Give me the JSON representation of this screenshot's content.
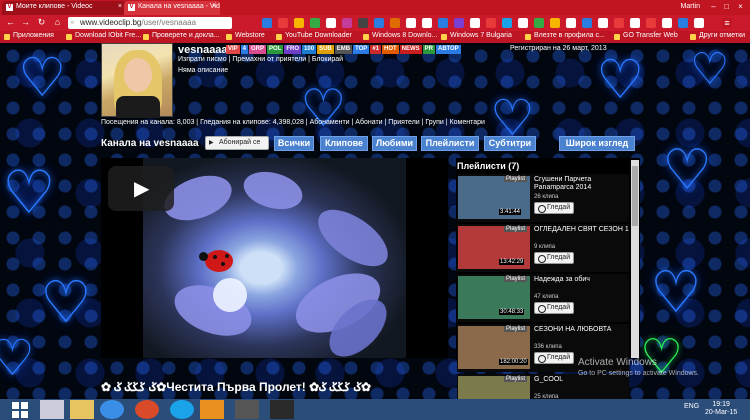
{
  "browser": {
    "tabs": [
      {
        "title": "Моите клипове - Videoc"
      },
      {
        "title": "Канала на vesnaaaa - Vid"
      }
    ],
    "user": "Martin",
    "url_host": "www.videoclip.bg",
    "url_path": "/user/vesnaaaa",
    "bookmarks": [
      "Приложения",
      "Download IObit Fre...",
      "Проверете и докла...",
      "Webstore",
      "YouTube Downloader",
      "Windows 8 Downlo...",
      "Windows 7 Bulgaria",
      "Влезте в профила с...",
      "GO Transfer Web",
      "Други отметки"
    ]
  },
  "channel": {
    "username": "vesnaaaa",
    "badges": [
      {
        "text": "VIP",
        "color": "#e04848"
      },
      {
        "text": "4",
        "color": "#2c7be5"
      },
      {
        "text": "GRP",
        "color": "#d94c8f"
      },
      {
        "text": "POL",
        "color": "#2c9a3c"
      },
      {
        "text": "FRO",
        "color": "#6f3fc8"
      },
      {
        "text": "100",
        "color": "#1c7dd0"
      },
      {
        "text": "SUB",
        "color": "#e0a000"
      },
      {
        "text": "EMB",
        "color": "#555555"
      },
      {
        "text": "TOP",
        "color": "#2c7be5"
      },
      {
        "text": "#1",
        "color": "#cc2a2a"
      },
      {
        "text": "HOT",
        "color": "#e05a00"
      },
      {
        "text": "NEWS",
        "color": "#c81e1e"
      },
      {
        "text": "PR",
        "color": "#2c9a3c"
      },
      {
        "text": "АВТОР",
        "color": "#2c7be5"
      }
    ],
    "registered": "Регистриран на 26 март, 2013",
    "links": "Изпрати писмо | Премахни от приятели | Блокирай",
    "no_name": "Няма описание",
    "stats": "Посещения на канала: 8,003 | Гледания на клипове: 4,398,028 | Абонаменти | Абонати | Приятели | Групи | Коментари",
    "channel_title": "Канала на vesnaaaa",
    "subscribe_label": "Абонирай се",
    "tabs": [
      "Всички",
      "Клипове",
      "Любими",
      "Плейлисти",
      "Субтитри"
    ],
    "wide_label": "Широк изглед",
    "video_caption": "✿ ݢ ݢݢݢ ݢ✿Честита Първа Пролет! ✿ݢ ݢݢݢ ݢ✿"
  },
  "playlists": {
    "title": "Плейлисти (7)",
    "tag": "Playlist",
    "watch_label": "Гледай",
    "items": [
      {
        "name": "Сгушени Парчета Panamparca 2014",
        "clips": "26 клипа",
        "duration": "3:41:44",
        "thumb": "#4a6a8a"
      },
      {
        "name": "ОГЛЕДАЛЕН СВЯТ СЕЗОН 1",
        "clips": "9 клипа",
        "duration": "13:42:29",
        "thumb": "#b23a3a"
      },
      {
        "name": "Надежда за обич",
        "clips": "47 клипа",
        "duration": "30:48:33",
        "thumb": "#3a7a5a"
      },
      {
        "name": "СЕЗОНИ НА ЛЮБОВТА",
        "clips": "336 клипа",
        "duration": "182:00:20",
        "thumb": "#8a6a4a"
      },
      {
        "name": "G_COOL",
        "clips": "25 клипа",
        "duration": "1:52:27",
        "thumb": "#7a7a4a"
      }
    ]
  },
  "activation": {
    "line1": "Activate Windows",
    "line2": "Go to PC settings to activate Windows."
  },
  "taskbar": {
    "lang": "ENG",
    "time": "19:19",
    "date": "20-Mar-15"
  }
}
